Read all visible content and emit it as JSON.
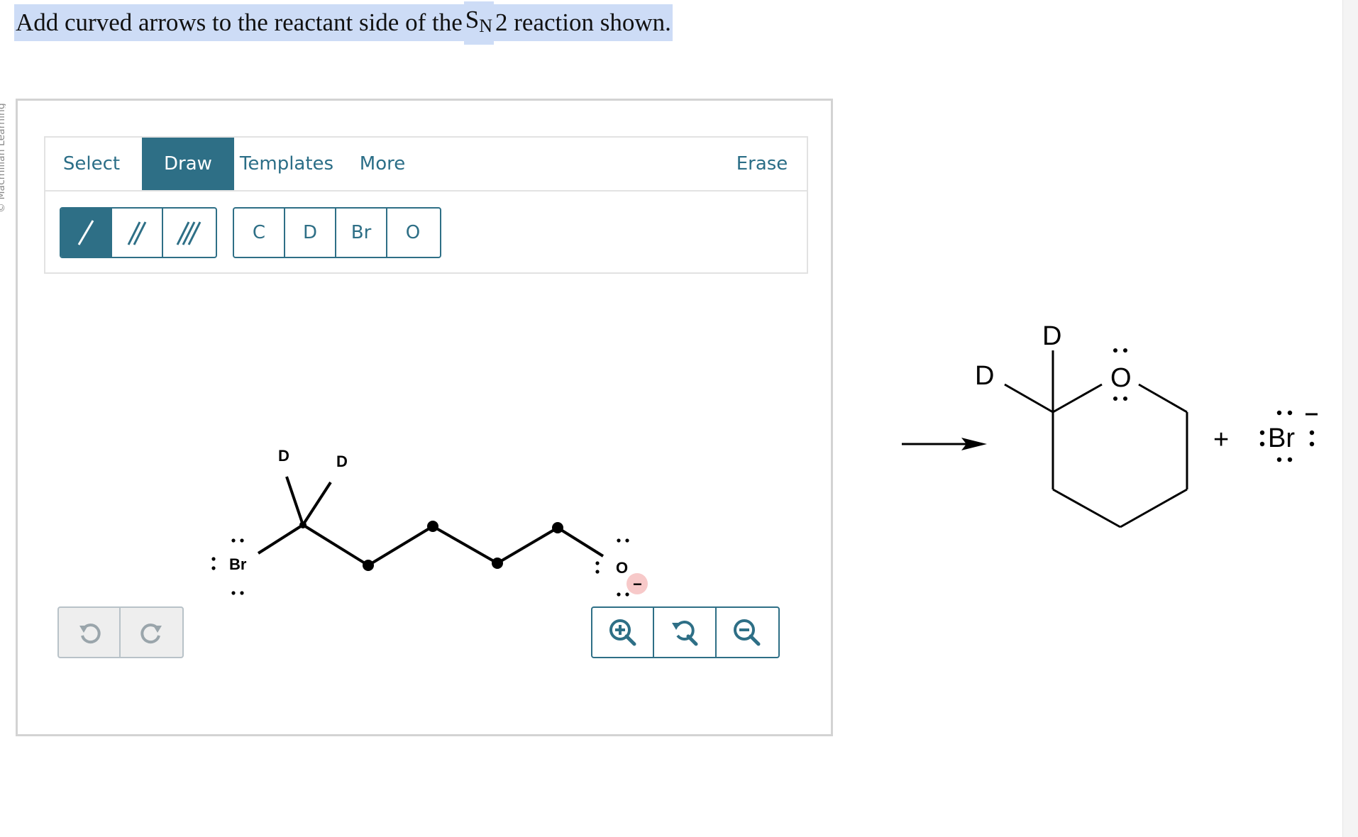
{
  "question": {
    "before": "Add curved arrows to the reactant side of the ",
    "s": "S",
    "sub": "N",
    "after": "2 reaction shown."
  },
  "side_credit": "© Macmillan Learning",
  "toolbar": {
    "menu": {
      "select": "Select",
      "draw": "Draw",
      "templates": "Templates",
      "more": "More",
      "erase": "Erase"
    },
    "active_menu": "Draw",
    "bonds": [
      "single-bond",
      "double-bond",
      "triple-bond"
    ],
    "active_bond": "single-bond",
    "atoms": [
      "C",
      "D",
      "Br",
      "O"
    ]
  },
  "canvas_molecule": {
    "atoms": {
      "d1": "D",
      "d2": "D",
      "br": "Br",
      "o": "O",
      "charge": "−"
    }
  },
  "product": {
    "d_top": "D",
    "d_left": "D",
    "ring_o": "O",
    "plus": "+",
    "br_label": "Br",
    "br_charge": "−"
  },
  "controls": {
    "undo": "undo-icon",
    "redo": "redo-icon",
    "zoom_in": "zoom-in-icon",
    "zoom_reset": "zoom-reset-icon",
    "zoom_out": "zoom-out-icon"
  },
  "colors": {
    "accent": "#2e6f86",
    "highlight": "#cddcf6",
    "charge_bubble": "#f7c9c9"
  }
}
